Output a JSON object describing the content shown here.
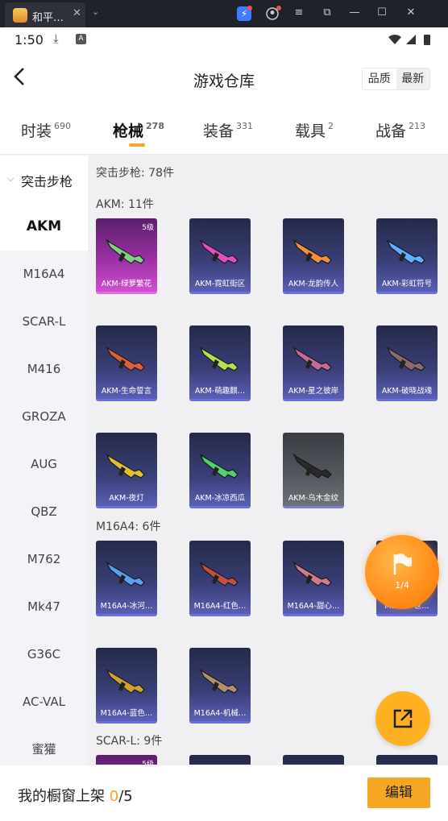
{
  "window": {
    "tab_title": "和平…",
    "tab_close": "✕",
    "dropdown": "⌄",
    "controls": [
      "≡",
      "⧉",
      "—",
      "☐",
      "✕"
    ]
  },
  "status_bar": {
    "time": "1:50",
    "download_icon": "⤓",
    "a_icon": "A"
  },
  "header": {
    "title": "游戏仓库",
    "sort_options": [
      "品质",
      "最新"
    ]
  },
  "categories": [
    {
      "label": "时装",
      "count": "690"
    },
    {
      "label": "枪械",
      "count": "278",
      "active": true
    },
    {
      "label": "装备",
      "count": "331"
    },
    {
      "label": "载具",
      "count": "2"
    },
    {
      "label": "战备",
      "count": "213"
    }
  ],
  "sidebar": {
    "group_label": "突击步枪",
    "items": [
      "AKM",
      "M16A4",
      "SCAR-L",
      "M416",
      "GROZA",
      "AUG",
      "QBZ",
      "M762",
      "Mk47",
      "G36C",
      "AC-VAL",
      "蜜獾"
    ]
  },
  "content": {
    "summary": "突击步枪: 78件",
    "sections": [
      {
        "title": "AKM: 11件",
        "items": [
          {
            "name": "AKM-绿萝繁花",
            "level": "5级",
            "style": "pink",
            "gun_color": "#7fd37f"
          },
          {
            "name": "AKM-霓虹街区",
            "style": "blue",
            "gun_color": "#e04fc0"
          },
          {
            "name": "AKM-龙韵传人",
            "style": "blue",
            "gun_color": "#f2913a"
          },
          {
            "name": "AKM-彩虹符号",
            "style": "blue",
            "gun_color": "#5fb0ff"
          },
          {
            "name": "AKM-生命誓言",
            "style": "blue",
            "gun_color": "#d9603a"
          },
          {
            "name": "AKM-萌趣麒…",
            "style": "blue",
            "gun_color": "#b6e04a"
          },
          {
            "name": "AKM-星之彼岸",
            "style": "blue",
            "gun_color": "#c46a9a"
          },
          {
            "name": "AKM-破晓战魂",
            "style": "blue",
            "gun_color": "#8a6a6a"
          },
          {
            "name": "AKM-夜灯",
            "style": "blue",
            "gun_color": "#e0c030"
          },
          {
            "name": "AKM-冰凉西瓜",
            "style": "blue",
            "gun_color": "#50d070"
          },
          {
            "name": "AKM-乌木金纹",
            "style": "gray",
            "gun_color": "#2a2a2a"
          }
        ]
      },
      {
        "title": "M16A4: 6件",
        "items": [
          {
            "name": "M16A4-冰河…",
            "style": "blue",
            "gun_color": "#5aa0f0"
          },
          {
            "name": "M16A4-红色…",
            "style": "blue",
            "gun_color": "#c05040"
          },
          {
            "name": "M16A4-甜心…",
            "style": "blue",
            "gun_color": "#d07a90"
          },
          {
            "name": "M16A4-世…",
            "style": "blue",
            "gun_color": "#7a80c0"
          },
          {
            "name": "M16A4-蓝色…",
            "style": "blue",
            "gun_color": "#d0a030"
          },
          {
            "name": "M16A4-机械…",
            "style": "blue",
            "gun_color": "#b09070"
          }
        ]
      },
      {
        "title": "SCAR-L: 9件",
        "items": [
          {
            "name": "",
            "level": "5级",
            "style": "pink",
            "gun_color": "#c04fc0"
          },
          {
            "name": "",
            "style": "blue",
            "gun_color": "#6070c0"
          },
          {
            "name": "",
            "style": "blue",
            "gun_color": "#6070c0"
          },
          {
            "name": "",
            "style": "blue",
            "gun_color": "#6070c0"
          }
        ]
      }
    ]
  },
  "float_counter": "1/4",
  "bottom": {
    "label": "我的橱窗上架",
    "current": "0",
    "total": "/5",
    "edit": "编辑"
  },
  "colors": {
    "accent": "#f5a623",
    "card_border": "#6a6fe0"
  }
}
